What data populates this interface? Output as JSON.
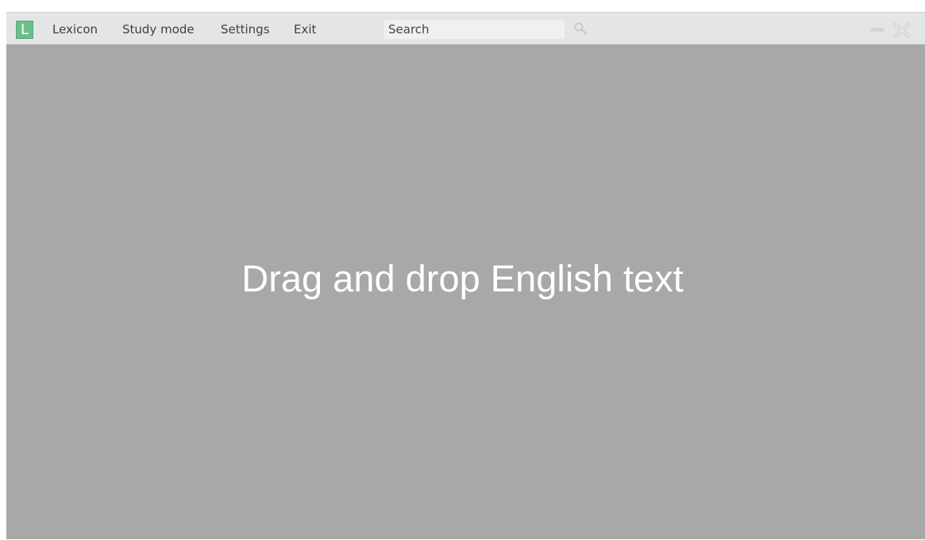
{
  "app": {
    "logo_letter": "L",
    "logo_color": "#6cbf8b"
  },
  "menu": {
    "items": [
      {
        "label": "Lexicon"
      },
      {
        "label": "Study mode"
      },
      {
        "label": "Settings"
      },
      {
        "label": "Exit"
      }
    ]
  },
  "search": {
    "value": "Search",
    "icon": "search-icon"
  },
  "window_controls": {
    "minimize_icon": "minimize-icon",
    "close_icon": "close-icon"
  },
  "drop_area": {
    "message": "Drag and drop English text",
    "background_color": "#a8a8a8"
  }
}
